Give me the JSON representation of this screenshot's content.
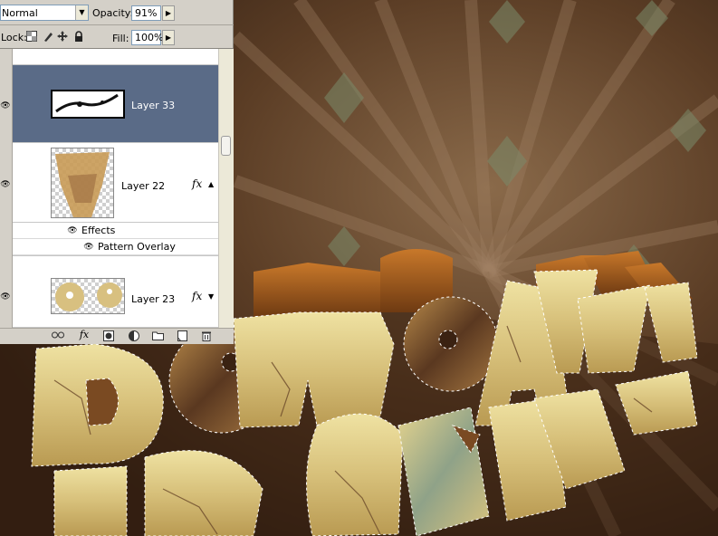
{
  "options_bar": {
    "blend_mode": "Normal",
    "opacity_label": "Opacity:",
    "opacity_value": "91%",
    "lock_label": "Lock:",
    "fill_label": "Fill:",
    "fill_value": "100%"
  },
  "layers": [
    {
      "name": "Layer 33",
      "selected": true,
      "has_fx": false
    },
    {
      "name": "Layer 22",
      "selected": false,
      "has_fx": true,
      "effects_label": "Effects",
      "effects": [
        "Pattern Overlay"
      ]
    },
    {
      "name": "Layer 23",
      "selected": false,
      "has_fx": true
    }
  ],
  "fx_symbol": "fx",
  "bottom_icons": [
    "link-icon",
    "fx-icon",
    "mask-icon",
    "adjustment-icon",
    "folder-icon",
    "new-layer-icon",
    "trash-icon"
  ],
  "colors": {
    "panel_bg": "#d4d0c8",
    "selected_row": "#5a6b87",
    "canvas_bg": "#3a2414"
  }
}
